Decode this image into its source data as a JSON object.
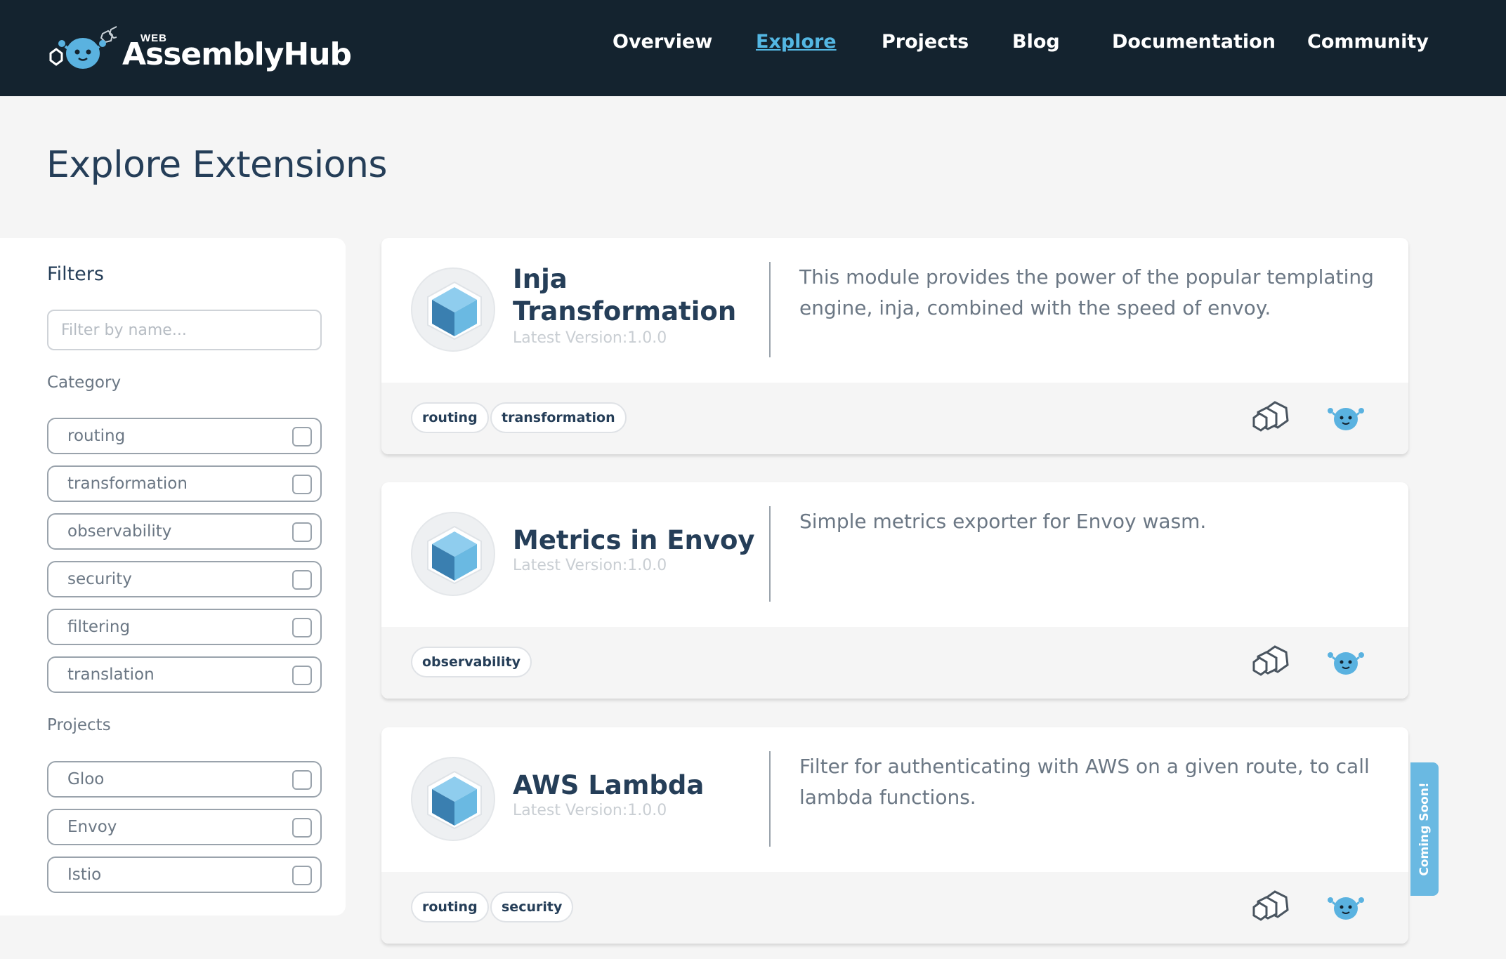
{
  "header": {
    "logo_small": "WEB",
    "logo_big": "AssemblyHub",
    "nav": [
      {
        "label": "Overview"
      },
      {
        "label": "Explore"
      },
      {
        "label": "Projects"
      },
      {
        "label": "Blog"
      },
      {
        "label": "Documentation"
      },
      {
        "label": "Community"
      }
    ],
    "active_nav": "Explore"
  },
  "page": {
    "title": "Explore Extensions"
  },
  "sidebar": {
    "title": "Filters",
    "search": {
      "placeholder": "Filter by name...",
      "value": ""
    },
    "category_label": "Category",
    "categories": [
      {
        "label": "routing",
        "checked": false
      },
      {
        "label": "transformation",
        "checked": false
      },
      {
        "label": "observability",
        "checked": false
      },
      {
        "label": "security",
        "checked": false
      },
      {
        "label": "filtering",
        "checked": false
      },
      {
        "label": "translation",
        "checked": false
      }
    ],
    "projects_label": "Projects",
    "projects": [
      {
        "label": "Gloo",
        "checked": false
      },
      {
        "label": "Envoy",
        "checked": false
      },
      {
        "label": "Istio",
        "checked": false
      }
    ]
  },
  "extensions": [
    {
      "name_line1": "Inja",
      "name_line2": "Transformation",
      "version": "Latest Version:1.0.0",
      "description": "This module provides the power of the popular templating engine, inja, combined with the speed of envoy.",
      "tags": [
        "routing",
        "transformation"
      ]
    },
    {
      "name_line1": "Metrics in Envoy",
      "name_line2": "",
      "version": "Latest Version:1.0.0",
      "description": "Simple metrics exporter for Envoy wasm.",
      "tags": [
        "observability"
      ]
    },
    {
      "name_line1": "AWS Lambda",
      "name_line2": "",
      "version": "Latest Version:1.0.0",
      "description": "Filter for authenticating with AWS on a given route, to call lambda functions.",
      "tags": [
        "routing",
        "security"
      ]
    }
  ],
  "card_footer_icons": [
    "envoy-hexagons-icon",
    "wasm-mascot-icon"
  ],
  "coming_soon": "Coming Soon!",
  "colors": {
    "header_bg": "#14232f",
    "accent": "#54b7e3",
    "text_dark": "#253e58",
    "text_muted": "#6b7784",
    "cube_light": "#6ab9e2",
    "cube_dark": "#3a7fb0"
  }
}
